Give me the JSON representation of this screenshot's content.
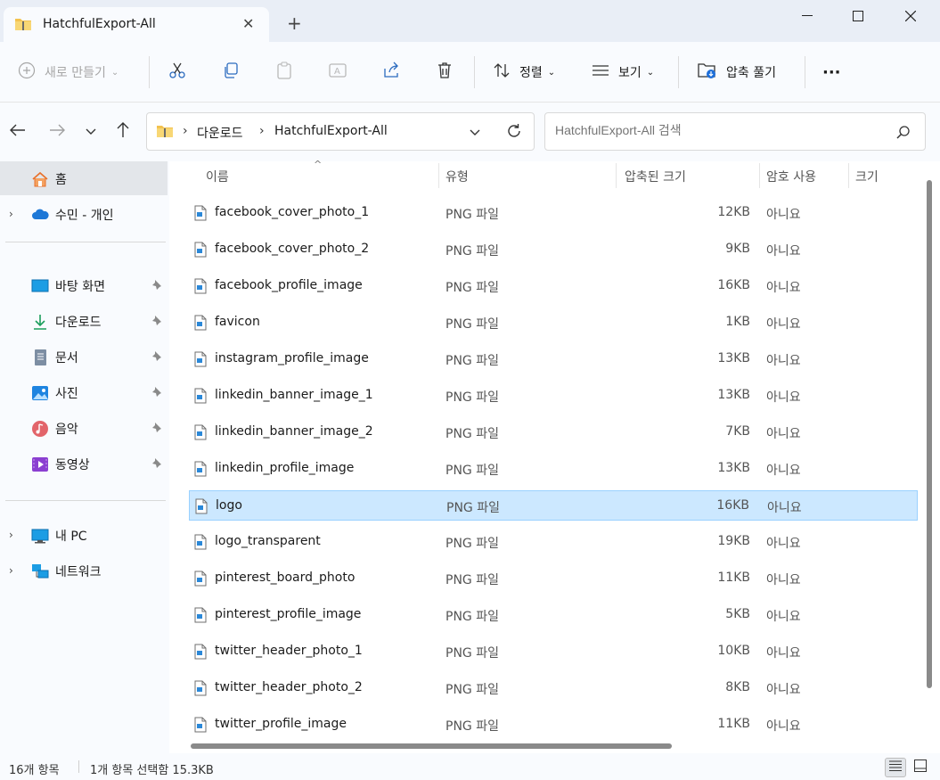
{
  "window": {
    "tab_title": "HatchfulExport-All",
    "new_tab": "+"
  },
  "toolbar": {
    "new_label": "새로 만들기",
    "sort_label": "정렬",
    "view_label": "보기",
    "extract_label": "압축 풀기",
    "more_label": "···"
  },
  "address": {
    "crumbs": [
      "다운로드",
      "HatchfulExport-All"
    ]
  },
  "search": {
    "placeholder": "HatchfulExport-All 검색"
  },
  "sidebar": {
    "home": "홈",
    "onedrive": "수민 - 개인",
    "quick": [
      {
        "label": "바탕 화면",
        "icon": "desktop-icon"
      },
      {
        "label": "다운로드",
        "icon": "download-icon"
      },
      {
        "label": "문서",
        "icon": "documents-icon"
      },
      {
        "label": "사진",
        "icon": "pictures-icon"
      },
      {
        "label": "음악",
        "icon": "music-icon"
      },
      {
        "label": "동영상",
        "icon": "videos-icon"
      }
    ],
    "this_pc": "내 PC",
    "network": "네트워크"
  },
  "columns": {
    "name": "이름",
    "type": "유형",
    "compressed": "압축된 크기",
    "password": "암호 사용",
    "size": "크기"
  },
  "files": [
    {
      "name": "facebook_cover_photo_1",
      "type": "PNG 파일",
      "compressed": "12KB",
      "password": "아니요"
    },
    {
      "name": "facebook_cover_photo_2",
      "type": "PNG 파일",
      "compressed": "9KB",
      "password": "아니요"
    },
    {
      "name": "facebook_profile_image",
      "type": "PNG 파일",
      "compressed": "16KB",
      "password": "아니요"
    },
    {
      "name": "favicon",
      "type": "PNG 파일",
      "compressed": "1KB",
      "password": "아니요"
    },
    {
      "name": "instagram_profile_image",
      "type": "PNG 파일",
      "compressed": "13KB",
      "password": "아니요"
    },
    {
      "name": "linkedin_banner_image_1",
      "type": "PNG 파일",
      "compressed": "13KB",
      "password": "아니요"
    },
    {
      "name": "linkedin_banner_image_2",
      "type": "PNG 파일",
      "compressed": "7KB",
      "password": "아니요"
    },
    {
      "name": "linkedin_profile_image",
      "type": "PNG 파일",
      "compressed": "13KB",
      "password": "아니요"
    },
    {
      "name": "logo",
      "type": "PNG 파일",
      "compressed": "16KB",
      "password": "아니요"
    },
    {
      "name": "logo_transparent",
      "type": "PNG 파일",
      "compressed": "19KB",
      "password": "아니요"
    },
    {
      "name": "pinterest_board_photo",
      "type": "PNG 파일",
      "compressed": "11KB",
      "password": "아니요"
    },
    {
      "name": "pinterest_profile_image",
      "type": "PNG 파일",
      "compressed": "5KB",
      "password": "아니요"
    },
    {
      "name": "twitter_header_photo_1",
      "type": "PNG 파일",
      "compressed": "10KB",
      "password": "아니요"
    },
    {
      "name": "twitter_header_photo_2",
      "type": "PNG 파일",
      "compressed": "8KB",
      "password": "아니요"
    },
    {
      "name": "twitter_profile_image",
      "type": "PNG 파일",
      "compressed": "11KB",
      "password": "아니요"
    }
  ],
  "status": {
    "count": "16개 항목",
    "selected": "1개 항목 선택함 15.3KB"
  }
}
